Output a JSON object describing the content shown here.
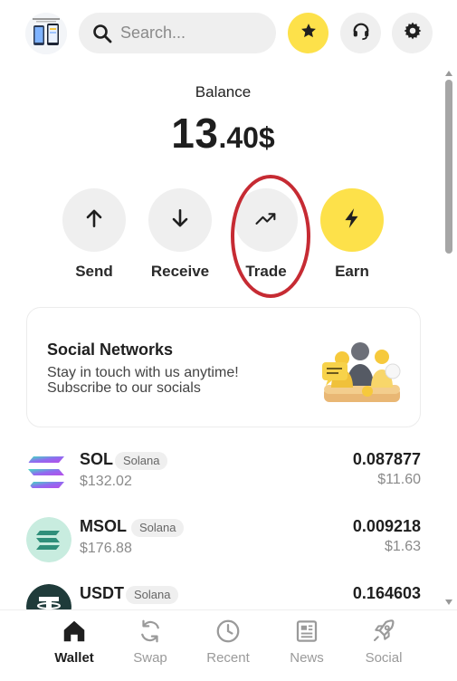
{
  "header": {
    "search_placeholder": "Search...",
    "icons": [
      "app-logo",
      "search-icon",
      "star-icon",
      "headset-icon",
      "gear-icon"
    ]
  },
  "balance": {
    "label": "Balance",
    "integer": "13",
    "decimal": ".40$"
  },
  "actions": [
    {
      "label": "Send",
      "icon": "arrow-up-icon"
    },
    {
      "label": "Receive",
      "icon": "arrow-down-icon"
    },
    {
      "label": "Trade",
      "icon": "trend-up-icon"
    },
    {
      "label": "Earn",
      "icon": "lightning-icon"
    }
  ],
  "social_card": {
    "title": "Social Networks",
    "text_line1": "Stay in touch with us anytime!",
    "text_line2": "Subscribe to our socials"
  },
  "tokens": [
    {
      "symbol": "SOL",
      "chain": "Solana",
      "price": "$132.02",
      "amount": "0.087877",
      "fiat": "$11.60"
    },
    {
      "symbol": "MSOL",
      "chain": "Solana",
      "price": "$176.88",
      "amount": "0.009218",
      "fiat": "$1.63"
    },
    {
      "symbol": "USDT",
      "chain": "Solana",
      "price": "",
      "amount": "0.164603",
      "fiat": ""
    }
  ],
  "nav": [
    {
      "label": "Wallet",
      "active": true
    },
    {
      "label": "Swap",
      "active": false
    },
    {
      "label": "Recent",
      "active": false
    },
    {
      "label": "News",
      "active": false
    },
    {
      "label": "Social",
      "active": false
    }
  ],
  "colors": {
    "accent_yellow": "#fde14a",
    "button_grey": "#efefef",
    "highlight_red": "#c62b33",
    "text_dark": "#1f1f1f",
    "text_muted": "#8a8a8a"
  }
}
